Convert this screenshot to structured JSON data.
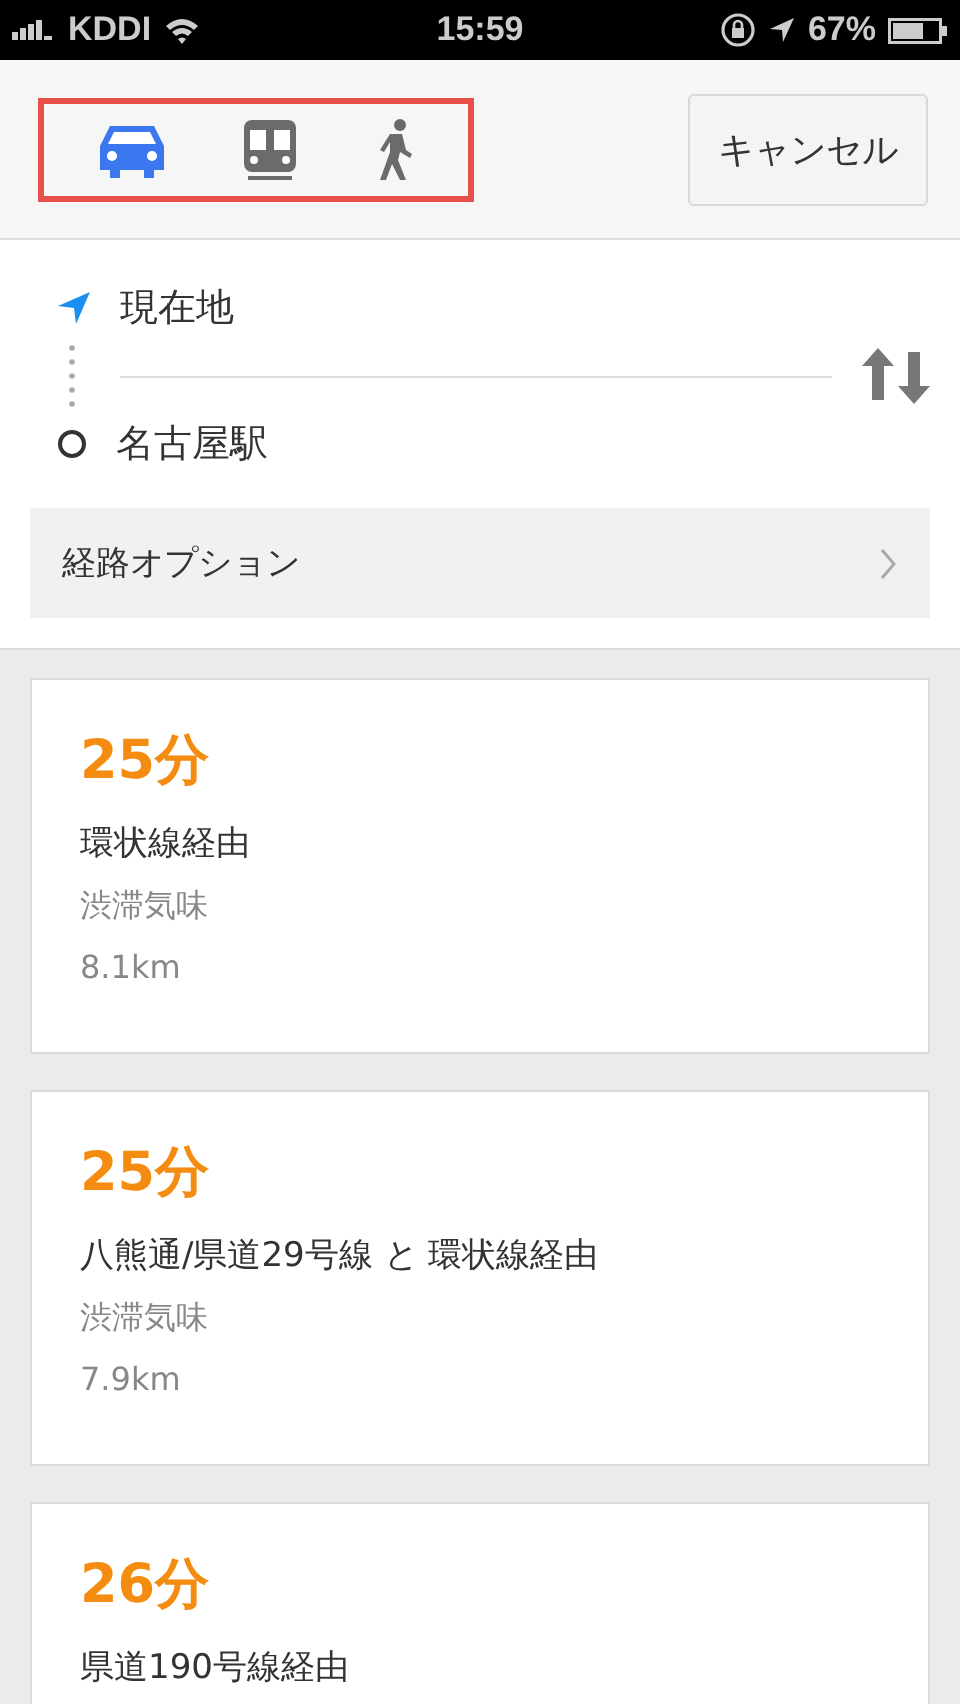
{
  "status_bar": {
    "carrier": "KDDI",
    "time": "15:59",
    "battery": "67%"
  },
  "modes": [
    {
      "kind": "car",
      "selected": true
    },
    {
      "kind": "train",
      "selected": false
    },
    {
      "kind": "walk",
      "selected": false
    }
  ],
  "cancel_button": "キャンセル",
  "route_form": {
    "origin": "現在地",
    "destination": "名古屋駅",
    "options": "経路オプション"
  },
  "routes": [
    {
      "duration": "25分",
      "via": "環状線経由",
      "traffic": "渋滞気味",
      "distance": "8.1km"
    },
    {
      "duration": "25分",
      "via": "八熊通/県道29号線 と 環状線経由",
      "traffic": "渋滞気味",
      "distance": "7.9km"
    },
    {
      "duration": "26分",
      "via": "県道190号線経由"
    }
  ]
}
